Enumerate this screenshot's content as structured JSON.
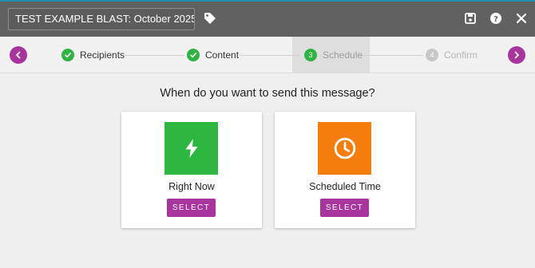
{
  "header": {
    "title_value": "TEST EXAMPLE BLAST: October 2025",
    "icons": [
      "tag-icon",
      "save-icon",
      "help-icon",
      "close-icon"
    ]
  },
  "stepper": {
    "steps": [
      {
        "number": "",
        "label": "Recipients",
        "state": "done"
      },
      {
        "number": "",
        "label": "Content",
        "state": "done"
      },
      {
        "number": "3",
        "label": "Schedule",
        "state": "active"
      },
      {
        "number": "4",
        "label": "Confirm",
        "state": "pending"
      }
    ],
    "prev_icon": "chevron-left-icon",
    "next_icon": "chevron-right-icon"
  },
  "main": {
    "question": "When do you want to send this message?",
    "options": [
      {
        "label": "Right Now",
        "button": "SELECT",
        "icon": "lightning-bolt-icon",
        "color": "#2db741"
      },
      {
        "label": "Scheduled Time",
        "button": "SELECT",
        "icon": "clock-icon",
        "color": "#f47d0c"
      }
    ]
  },
  "colors": {
    "accent": "#a8359d",
    "toolbar": "#616161",
    "success": "#2fb341"
  }
}
